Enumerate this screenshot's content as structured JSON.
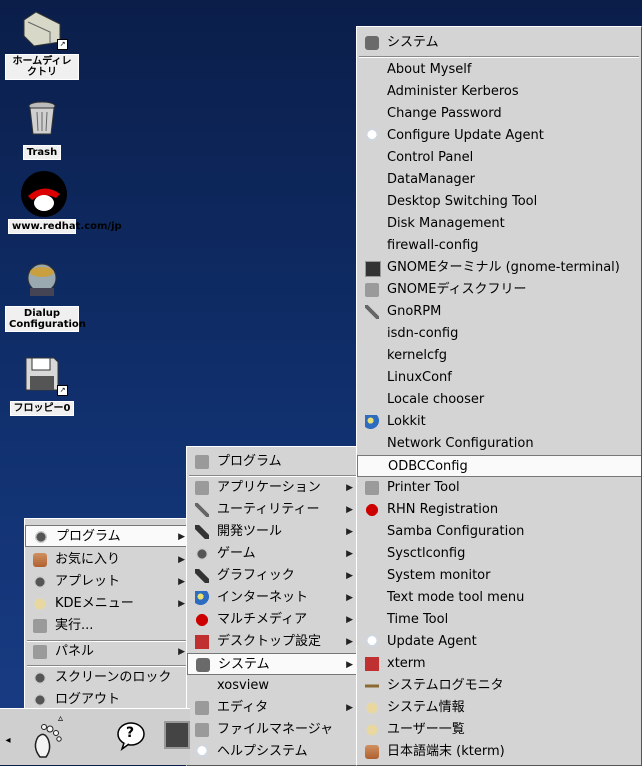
{
  "desktop_icons": [
    {
      "id": "home",
      "label": "ホームディレクトリ"
    },
    {
      "id": "trash",
      "label": "Trash"
    },
    {
      "id": "redhat",
      "label": "www.redhat.com/jp"
    },
    {
      "id": "dialup",
      "label": "Dialup Configuration"
    },
    {
      "id": "floppy",
      "label": "フロッピー0"
    }
  ],
  "main_menu": {
    "items": [
      {
        "label": "プログラム"
      },
      {
        "label": "お気に入り"
      },
      {
        "label": "アプレット"
      },
      {
        "label": "KDEメニュー"
      },
      {
        "label": "実行..."
      },
      {
        "label": "パネル"
      },
      {
        "label": "スクリーンのロック"
      },
      {
        "label": "ログアウト"
      }
    ]
  },
  "programs_menu": {
    "header": "プログラム",
    "items": [
      {
        "label": "アプリケーション"
      },
      {
        "label": "ユーティリティー"
      },
      {
        "label": "開発ツール"
      },
      {
        "label": "ゲーム"
      },
      {
        "label": "グラフィック"
      },
      {
        "label": "インターネット"
      },
      {
        "label": "マルチメディア"
      },
      {
        "label": "デスクトップ設定"
      },
      {
        "label": "システム"
      },
      {
        "label": "xosview"
      },
      {
        "label": "エディタ"
      },
      {
        "label": "ファイルマネージャ"
      },
      {
        "label": "ヘルプシステム"
      }
    ]
  },
  "system_menu": {
    "header": "システム",
    "items": [
      {
        "label": "About Myself"
      },
      {
        "label": "Administer Kerberos"
      },
      {
        "label": "Change Password"
      },
      {
        "label": "Configure Update Agent"
      },
      {
        "label": "Control Panel"
      },
      {
        "label": "DataManager"
      },
      {
        "label": "Desktop Switching Tool"
      },
      {
        "label": "Disk Management"
      },
      {
        "label": "firewall-config"
      },
      {
        "label": "GNOMEターミナル (gnome-terminal)"
      },
      {
        "label": "GNOMEディスクフリー"
      },
      {
        "label": "GnoRPM"
      },
      {
        "label": "isdn-config"
      },
      {
        "label": "kernelcfg"
      },
      {
        "label": "LinuxConf"
      },
      {
        "label": "Locale chooser"
      },
      {
        "label": "Lokkit"
      },
      {
        "label": "Network Configuration"
      },
      {
        "label": "ODBCConfig"
      },
      {
        "label": "Printer Tool"
      },
      {
        "label": "RHN Registration"
      },
      {
        "label": "Samba Configuration"
      },
      {
        "label": "Sysctlconfig"
      },
      {
        "label": "System monitor"
      },
      {
        "label": "Text mode tool menu"
      },
      {
        "label": "Time Tool"
      },
      {
        "label": "Update Agent"
      },
      {
        "label": "xterm"
      },
      {
        "label": "システムログモニタ"
      },
      {
        "label": "システム情報"
      },
      {
        "label": "ユーザー一覧"
      },
      {
        "label": "日本語端末 (kterm)"
      }
    ]
  },
  "panel": {
    "help_glyph": "?",
    "left_arrow": "◂",
    "up_arrow": "▵"
  }
}
